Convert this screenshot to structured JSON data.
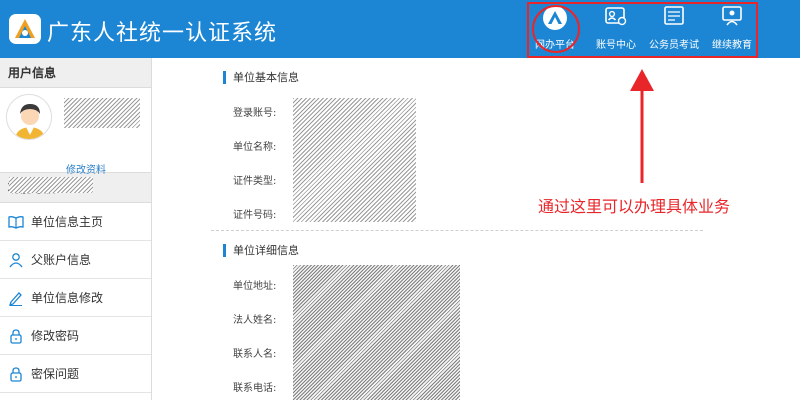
{
  "header": {
    "title": "广东人社统一认证系统",
    "logo_icon": "guangdong-hrss-logo",
    "nav": [
      {
        "label": "网办平台",
        "icon": "office-platform-icon"
      },
      {
        "label": "账号中心",
        "icon": "account-card-icon"
      },
      {
        "label": "公务员考试",
        "icon": "exam-icon"
      },
      {
        "label": "继续教育",
        "icon": "education-icon"
      }
    ]
  },
  "sidebar": {
    "user_section_title": "用户信息",
    "edit_profile": "修改资料",
    "nav_section_title": "功能导航",
    "items": [
      {
        "label": "单位信息主页",
        "icon": "book-icon"
      },
      {
        "label": "父账户信息",
        "icon": "user-icon"
      },
      {
        "label": "单位信息修改",
        "icon": "pen-icon"
      },
      {
        "label": "修改密码",
        "icon": "lock-icon"
      },
      {
        "label": "密保问题",
        "icon": "lock-icon"
      }
    ]
  },
  "main": {
    "basic": {
      "title": "单位基本信息",
      "fields": [
        "登录账号:",
        "单位名称:",
        "证件类型:",
        "证件号码:"
      ]
    },
    "detail": {
      "title": "单位详细信息",
      "fields": [
        "单位地址:",
        "法人姓名:",
        "联系人名:",
        "联系电话:"
      ]
    }
  },
  "annotation": {
    "text": "通过这里可以办理具体业务",
    "color": "#e8262a"
  },
  "colors": {
    "brand_blue": "#1c86d4",
    "annotation_red": "#e8262a"
  }
}
